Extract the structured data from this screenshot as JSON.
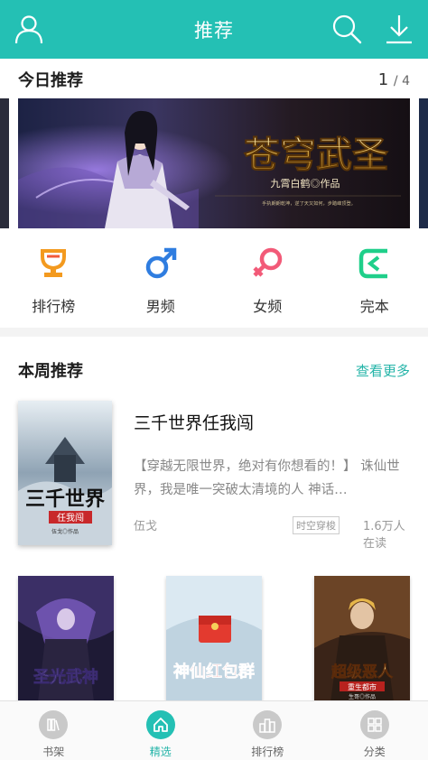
{
  "header": {
    "title": "推荐",
    "icons": [
      "user-icon",
      "search-icon",
      "download-icon"
    ]
  },
  "today": {
    "title": "今日推荐",
    "page_current": "1",
    "page_sep_total": "/ 4",
    "banner": {
      "book_title": "苍穹武圣",
      "author_line": "九霄白鹤◎作品",
      "tagline": "手执朗朗乾坤，逆了天又如何，步踏峰顶登。"
    }
  },
  "categories": [
    {
      "label": "排行榜",
      "icon": "trophy-icon",
      "color": "#f39a1f"
    },
    {
      "label": "男频",
      "icon": "male-icon",
      "color": "#2f7de0"
    },
    {
      "label": "女频",
      "icon": "female-icon",
      "color": "#f25a78"
    },
    {
      "label": "完本",
      "icon": "book-complete-icon",
      "color": "#1fcf8a"
    }
  ],
  "weekly": {
    "title": "本周推荐",
    "more": "查看更多",
    "featured": {
      "title": "三千世界任我闯",
      "desc": "【穿越无限世界，绝对有你想看的！】 诛仙世界，我是唯一突破太清境的人 神话…",
      "author": "伍戈",
      "tag": "时空穿梭",
      "readers": "1.6万人在读",
      "cover_title": "三千世界",
      "cover_sub": "任我闯",
      "cover_author": "伍戈◎作品"
    },
    "books": [
      {
        "cover_title": "圣光武神"
      },
      {
        "cover_title": "神仙红包群"
      },
      {
        "cover_title": "超级恶人",
        "cover_sub": "重生都市",
        "cover_author": "生哥◎作品"
      }
    ]
  },
  "tabbar": [
    {
      "label": "书架",
      "active": false,
      "icon": "bookshelf-icon"
    },
    {
      "label": "精选",
      "active": true,
      "icon": "home-icon"
    },
    {
      "label": "排行榜",
      "active": false,
      "icon": "ranking-icon"
    },
    {
      "label": "分类",
      "active": false,
      "icon": "category-grid-icon"
    }
  ],
  "colors": {
    "accent": "#24c0b4",
    "more_link": "#24b4a8"
  }
}
